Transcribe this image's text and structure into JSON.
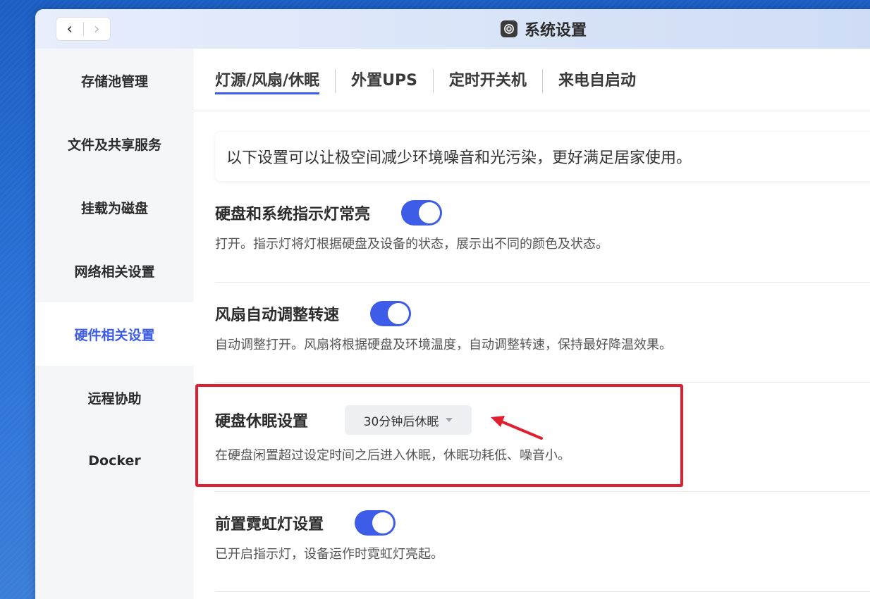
{
  "window": {
    "title": "系统设置",
    "back_glyph": "‹",
    "forward_glyph": "›"
  },
  "sidebar": {
    "items": [
      {
        "label": "存储池管理"
      },
      {
        "label": "文件及共享服务"
      },
      {
        "label": "挂载为磁盘"
      },
      {
        "label": "网络相关设置"
      },
      {
        "label": "硬件相关设置",
        "active": true
      },
      {
        "label": "远程协助"
      },
      {
        "label": "Docker"
      }
    ]
  },
  "tabs": [
    {
      "label": "灯源/风扇/休眠",
      "active": true
    },
    {
      "label": "外置UPS"
    },
    {
      "label": "定时开关机"
    },
    {
      "label": "来电自启动"
    }
  ],
  "notice": "以下设置可以让极空间减少环境噪音和光污染，更好满足居家使用。",
  "settings": {
    "led": {
      "title": "硬盘和系统指示灯常亮",
      "desc": "打开。指示灯将灯根据硬盘及设备的状态，展示出不同的颜色及状态。",
      "enabled": true
    },
    "fan": {
      "title": "风扇自动调整转速",
      "desc": "自动调整打开。风扇将根据硬盘及环境温度，自动调整转速，保持最好降温效果。",
      "enabled": true
    },
    "sleep": {
      "title": "硬盘休眠设置",
      "selected": "30分钟后休眠",
      "desc": "在硬盘闲置超过设定时间之后进入休眠，休眠功耗低、噪音小。"
    },
    "neon": {
      "title": "前置霓虹灯设置",
      "desc": "已开启指示灯，设备运作时霓虹灯亮起。",
      "enabled": true
    }
  },
  "colors": {
    "accent": "#3d5ce8",
    "annotation": "#e02030"
  }
}
